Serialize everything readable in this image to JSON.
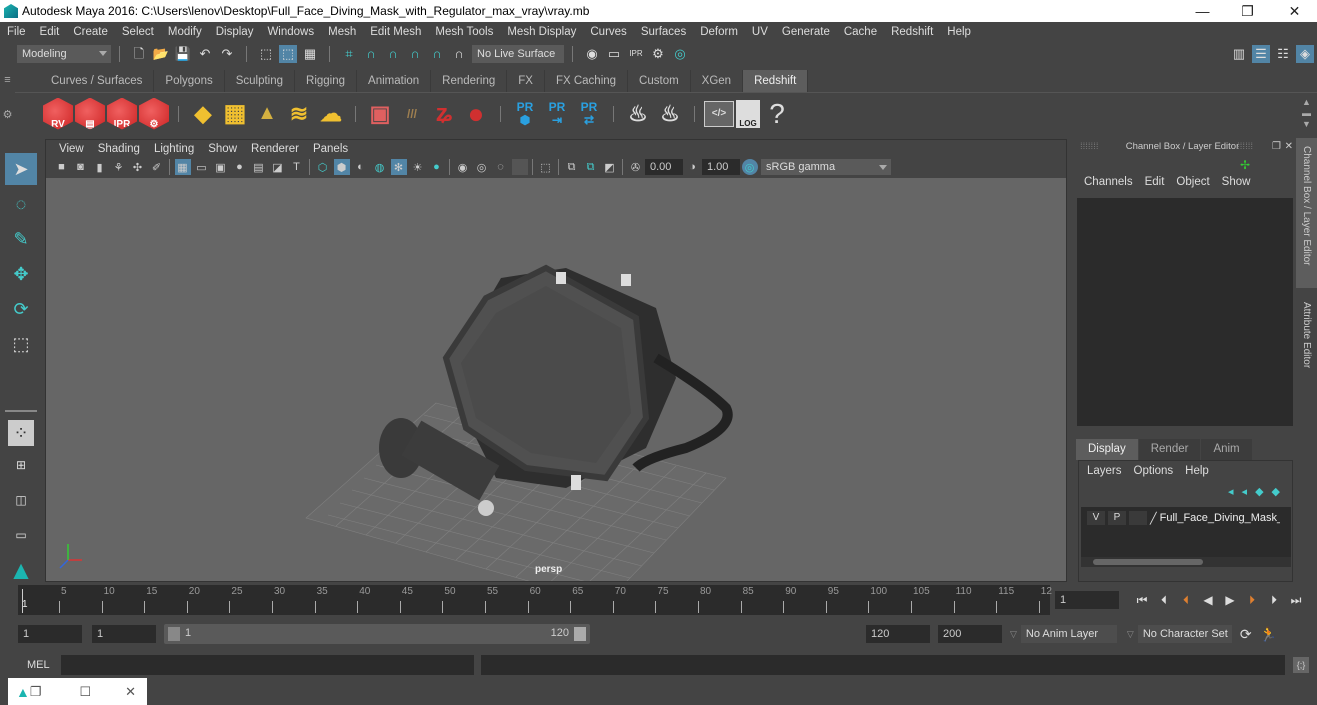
{
  "window": {
    "title": "Autodesk Maya 2016: C:\\Users\\lenov\\Desktop\\Full_Face_Diving_Mask_with_Regulator_max_vray\\vray.mb",
    "minimize": "—",
    "maximize": "❐",
    "close": "✕"
  },
  "menubar": [
    "File",
    "Edit",
    "Create",
    "Select",
    "Modify",
    "Display",
    "Windows",
    "Mesh",
    "Edit Mesh",
    "Mesh Tools",
    "Mesh Display",
    "Curves",
    "Surfaces",
    "Deform",
    "UV",
    "Generate",
    "Cache",
    "Redshift",
    "Help"
  ],
  "statusline": {
    "mode": "Modeling",
    "live_surface": "No Live Surface"
  },
  "shelf": {
    "tabs": [
      "Curves / Surfaces",
      "Polygons",
      "Sculpting",
      "Rigging",
      "Animation",
      "Rendering",
      "FX",
      "FX Caching",
      "Custom",
      "XGen",
      "Redshift"
    ],
    "active_tab": "Redshift",
    "icons": [
      {
        "name": "redshift-renderview-icon",
        "label": "RV"
      },
      {
        "name": "redshift-batch-render-icon",
        "label": "▤"
      },
      {
        "name": "redshift-ipr-icon",
        "label": "IPR"
      },
      {
        "name": "redshift-settings-icon",
        "label": "⚙"
      },
      {
        "name": "redshift-light-quad-icon",
        "label": "◆"
      },
      {
        "name": "redshift-area-light-icon",
        "label": "▦"
      },
      {
        "name": "redshift-spot-light-icon",
        "label": "▲"
      },
      {
        "name": "redshift-dome-light-icon",
        "label": "≋"
      },
      {
        "name": "redshift-sun-light-icon",
        "label": "☁"
      },
      {
        "name": "redshift-volume-icon",
        "label": "▣"
      },
      {
        "name": "redshift-hair-icon",
        "label": "///"
      },
      {
        "name": "redshift-shader-node-icon",
        "label": "ʑ"
      },
      {
        "name": "redshift-material-icon",
        "label": "●"
      },
      {
        "name": "redshift-proxy-icon",
        "label": "PR"
      },
      {
        "name": "redshift-proxy-export-icon",
        "label": "PR"
      },
      {
        "name": "redshift-proxy-swap-icon",
        "label": "PR"
      },
      {
        "name": "redshift-bake-multi-icon",
        "label": "♨"
      },
      {
        "name": "redshift-bake-icon",
        "label": "♨"
      },
      {
        "name": "redshift-script-editor-icon",
        "label": "</>"
      },
      {
        "name": "redshift-log-icon",
        "label": "LOG"
      },
      {
        "name": "help-icon",
        "label": "?"
      }
    ]
  },
  "viewport": {
    "menu": [
      "View",
      "Shading",
      "Lighting",
      "Show",
      "Renderer",
      "Panels"
    ],
    "exposure": "0.00",
    "gamma": "1.00",
    "color_space": "sRGB gamma",
    "camera_label": "persp"
  },
  "channel_box": {
    "title": "Channel Box / Layer Editor",
    "menu": [
      "Channels",
      "Edit",
      "Object",
      "Show"
    ],
    "layer_tabs": [
      "Display",
      "Render",
      "Anim"
    ],
    "active_layer_tab": "Display",
    "layer_menu": [
      "Layers",
      "Options",
      "Help"
    ],
    "layers": [
      {
        "v": "V",
        "p": "P",
        "name": "Full_Face_Diving_Mask_w"
      }
    ]
  },
  "side_tabs": [
    "Channel Box / Layer Editor",
    "Attribute Editor"
  ],
  "timeline": {
    "ticks": [
      5,
      10,
      15,
      20,
      25,
      30,
      35,
      40,
      45,
      50,
      55,
      60,
      65,
      70,
      75,
      80,
      85,
      90,
      95,
      100,
      105,
      110,
      115,
      "12"
    ],
    "current_frame_marker": "1",
    "current_frame": "1"
  },
  "range": {
    "start": "1",
    "playback_start": "1",
    "slider_start": "1",
    "slider_end": "120",
    "playback_end": "120",
    "end": "200",
    "anim_layer": "No Anim Layer",
    "character_set": "No Character Set"
  },
  "command": {
    "label": "MEL",
    "input": "",
    "output": ""
  }
}
